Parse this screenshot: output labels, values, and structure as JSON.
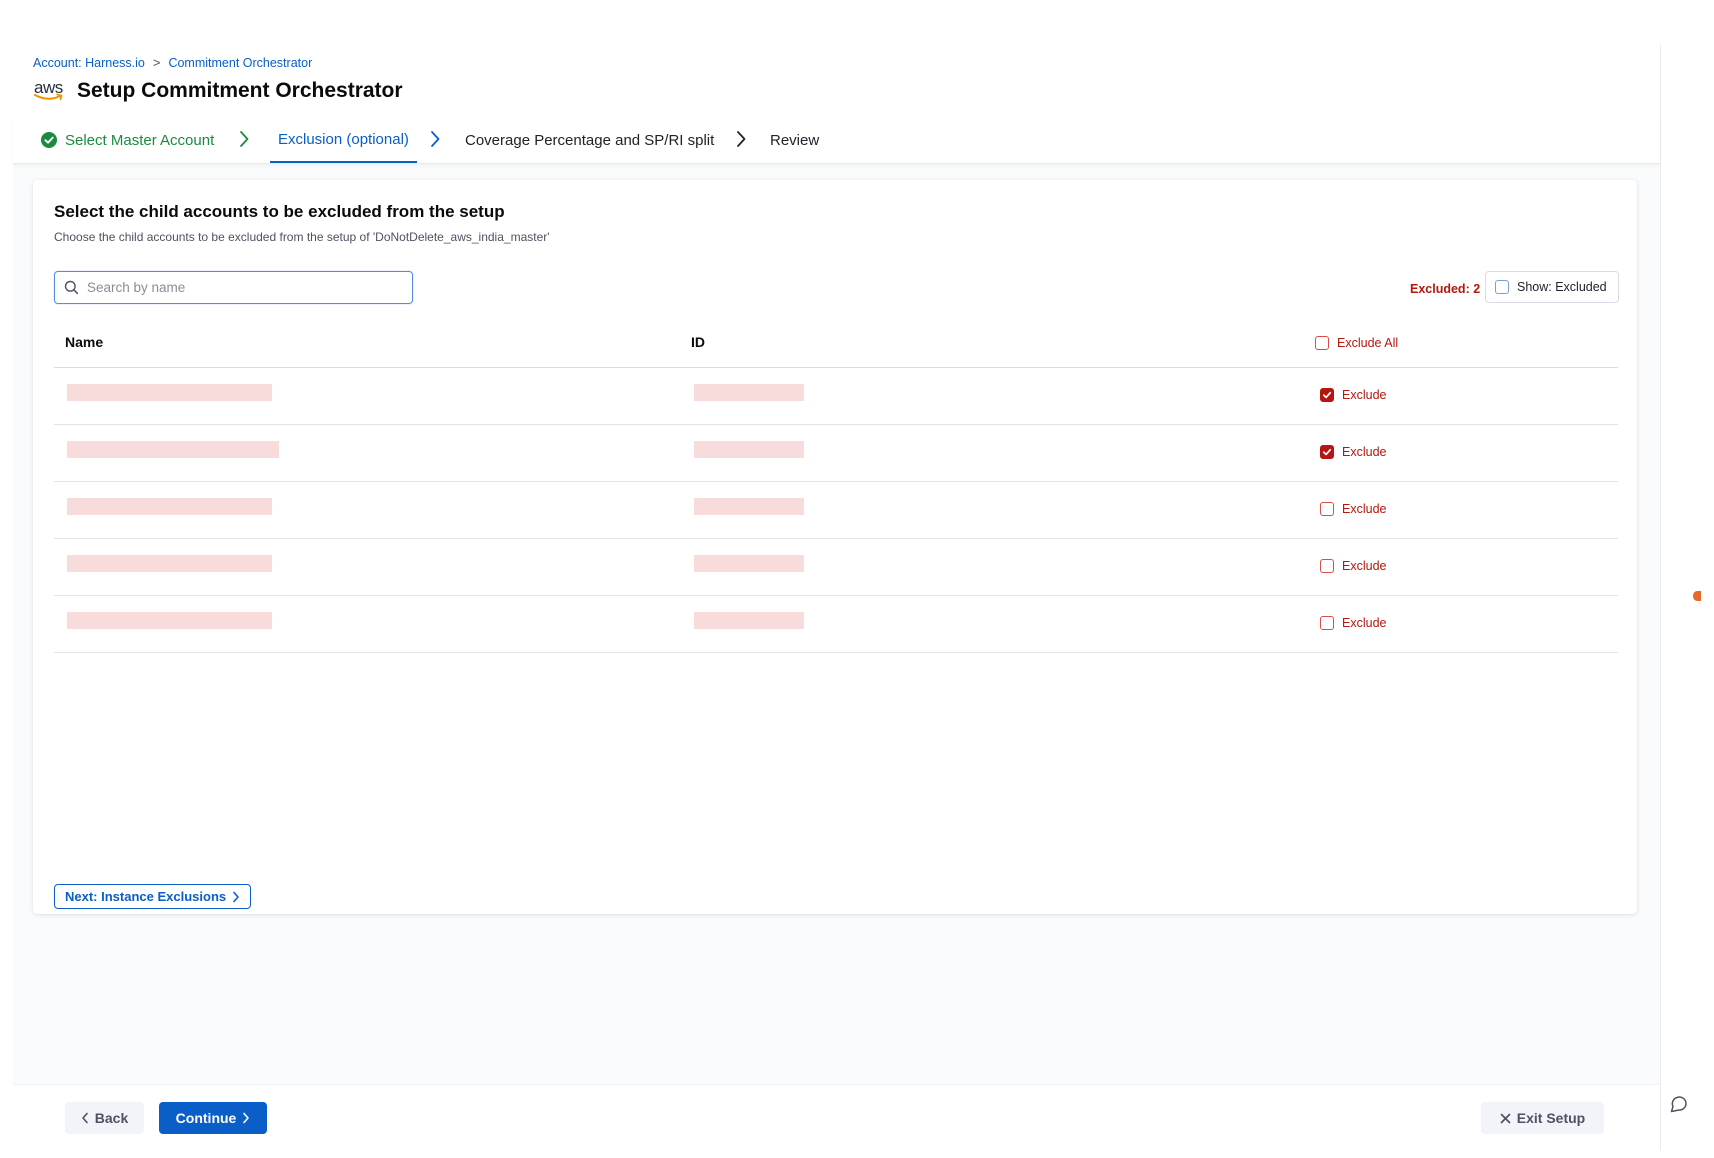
{
  "breadcrumb": {
    "account": "Account: Harness.io",
    "separator": ">",
    "current": "Commitment Orchestrator"
  },
  "header": {
    "logo_text": "aws",
    "title": "Setup Commitment Orchestrator"
  },
  "stepper": {
    "steps": [
      {
        "label": "Select Master Account",
        "status": "completed"
      },
      {
        "label": "Exclusion (optional)",
        "status": "active"
      },
      {
        "label": "Coverage Percentage and SP/RI split",
        "status": "pending"
      },
      {
        "label": "Review",
        "status": "pending"
      }
    ]
  },
  "card": {
    "title": "Select the child accounts to be excluded from the setup",
    "subtitle": "Choose the child accounts to be excluded from the setup of 'DoNotDelete_aws_india_master'"
  },
  "search": {
    "placeholder": "Search by name",
    "value": ""
  },
  "filters": {
    "excluded_count": "Excluded: 2",
    "show_excluded_label": "Show: Excluded",
    "show_excluded_checked": false
  },
  "table": {
    "columns": {
      "name": "Name",
      "id": "ID",
      "exclude_all": "Exclude All"
    },
    "rows": [
      {
        "name": "",
        "id": "",
        "exclude_label": "Exclude",
        "excluded": true
      },
      {
        "name": "",
        "id": "",
        "exclude_label": "Exclude",
        "excluded": true
      },
      {
        "name": "",
        "id": "",
        "exclude_label": "Exclude",
        "excluded": false
      },
      {
        "name": "",
        "id": "",
        "exclude_label": "Exclude",
        "excluded": false
      },
      {
        "name": "",
        "id": "",
        "exclude_label": "Exclude",
        "excluded": false
      }
    ]
  },
  "actions": {
    "next_label": "Next: Instance Exclusions",
    "back_label": "Back",
    "continue_label": "Continue",
    "exit_label": "Exit Setup"
  },
  "colors": {
    "primary": "#0a5ec8",
    "success": "#1b8a3e",
    "danger": "#b41710",
    "redacted": "#f8dcdc"
  },
  "icons": {
    "step_completed": "check-circle-icon",
    "search": "search-icon",
    "checkbox_checked": "check-icon",
    "help": "chat-help-icon"
  }
}
